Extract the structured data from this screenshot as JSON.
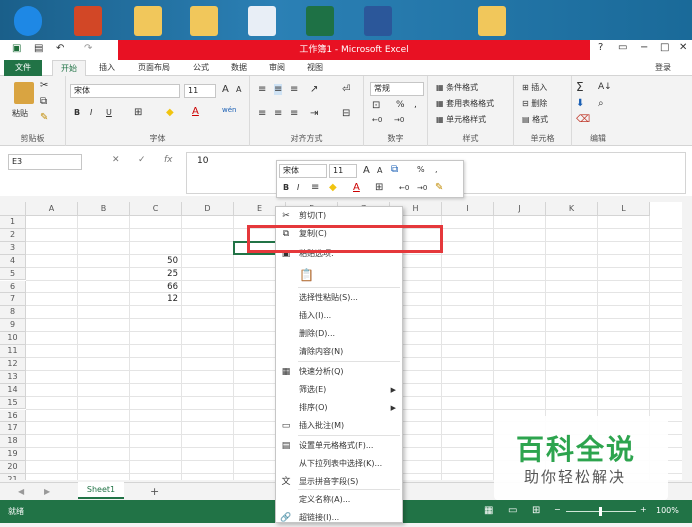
{
  "window": {
    "title": "工作簿1 - Microsoft Excel",
    "help": "?",
    "sign_in": "登录"
  },
  "tabs": [
    "文件",
    "开始",
    "插入",
    "页面布局",
    "公式",
    "数据",
    "审阅",
    "视图"
  ],
  "ribbon": {
    "clipboard": {
      "label": "剪贴板",
      "paste": "粘贴"
    },
    "font": {
      "label": "字体",
      "name": "宋体",
      "size": "11",
      "bold": "B",
      "italic": "I",
      "underline": "U",
      "grow": "A",
      "shrink": "A",
      "color": "A"
    },
    "alignment": {
      "label": "对齐方式"
    },
    "number": {
      "label": "数字",
      "format": "常规",
      "percent": "%",
      "comma": ","
    },
    "styles": {
      "label": "样式",
      "items": [
        "条件格式",
        "套用表格格式",
        "单元格样式"
      ]
    },
    "cells": {
      "label": "单元格",
      "items": [
        "插入",
        "删除",
        "格式"
      ]
    },
    "editing": {
      "label": "编辑"
    }
  },
  "formula_bar": {
    "name_box": "E3",
    "fx": "fx",
    "value": "10"
  },
  "columns": [
    "A",
    "B",
    "C",
    "D",
    "E",
    "F",
    "G",
    "H",
    "I",
    "J",
    "K",
    "L"
  ],
  "rows": [
    "1",
    "2",
    "3",
    "4",
    "5",
    "6",
    "7",
    "8",
    "9",
    "10",
    "11",
    "12",
    "13",
    "14",
    "15",
    "16",
    "17",
    "18",
    "19",
    "20",
    "21"
  ],
  "cells": [
    {
      "row": 4,
      "col": "C",
      "value": "50"
    },
    {
      "row": 5,
      "col": "C",
      "value": "25"
    },
    {
      "row": 6,
      "col": "C",
      "value": "66"
    },
    {
      "row": 7,
      "col": "C",
      "value": "12"
    }
  ],
  "mini_toolbar": {
    "font": "宋体",
    "size": "11",
    "percent": "%",
    "comma": ","
  },
  "context_menu": [
    {
      "label": "剪切(T)",
      "icon": "scissors-icon"
    },
    {
      "label": "复制(C)",
      "icon": "copy-icon"
    },
    {
      "label": "粘贴选项:",
      "icon": "paste-icon"
    },
    {
      "label": "",
      "icon": "paste-clipboard-icon"
    },
    {
      "label": "选择性粘贴(S)...",
      "icon": ""
    },
    {
      "label": "插入(I)...",
      "icon": ""
    },
    {
      "label": "删除(D)...",
      "icon": ""
    },
    {
      "label": "清除内容(N)",
      "icon": ""
    },
    {
      "label": "快速分析(Q)",
      "icon": "quick-analysis-icon"
    },
    {
      "label": "筛选(E)",
      "icon": "",
      "submenu": true
    },
    {
      "label": "排序(O)",
      "icon": "",
      "submenu": true
    },
    {
      "label": "插入批注(M)",
      "icon": "comment-icon"
    },
    {
      "label": "设置单元格格式(F)...",
      "icon": "format-cells-icon"
    },
    {
      "label": "从下拉列表中选择(K)...",
      "icon": ""
    },
    {
      "label": "显示拼音字段(S)",
      "icon": "phonetic-icon"
    },
    {
      "label": "定义名称(A)...",
      "icon": ""
    },
    {
      "label": "超链接(I)...",
      "icon": "hyperlink-icon"
    }
  ],
  "sheet": {
    "name": "Sheet1",
    "add": "+"
  },
  "status": {
    "left": "就绪",
    "zoom": "100%"
  },
  "watermark": {
    "title": "百科全说",
    "subtitle": "助你轻松解决"
  }
}
